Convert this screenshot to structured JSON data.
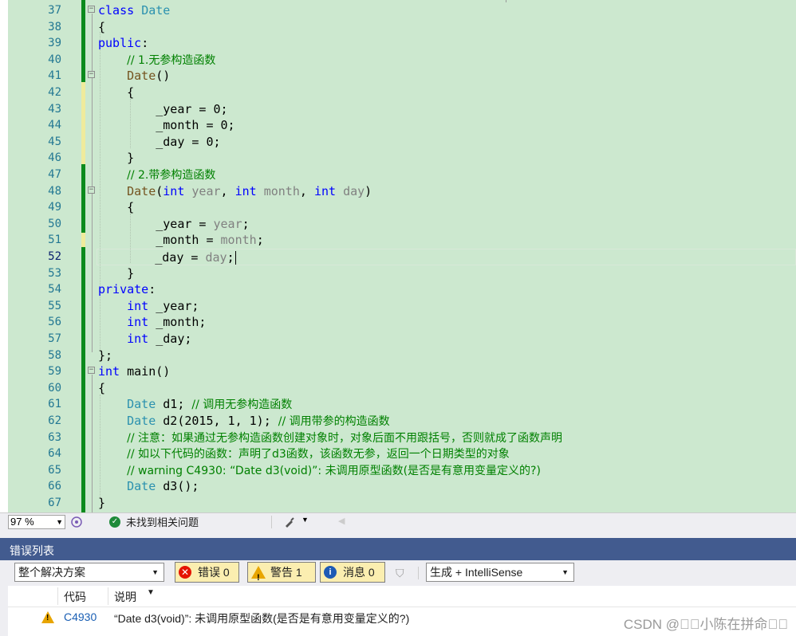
{
  "editor": {
    "lines": [
      {
        "n": "37",
        "segs": [
          [
            "kw",
            "class"
          ],
          [
            "",
            " "
          ],
          [
            "ty",
            "Date"
          ]
        ]
      },
      {
        "n": "38",
        "segs": [
          [
            "",
            "{"
          ]
        ]
      },
      {
        "n": "39",
        "segs": [
          [
            "kw",
            "public"
          ],
          [
            "",
            ":"
          ]
        ]
      },
      {
        "n": "40",
        "segs": [
          [
            "",
            "    "
          ],
          [
            "cm",
            "// 1.无参构造函数"
          ]
        ]
      },
      {
        "n": "41",
        "segs": [
          [
            "",
            "    "
          ],
          [
            "fn",
            "Date"
          ],
          [
            "",
            "()"
          ]
        ]
      },
      {
        "n": "42",
        "segs": [
          [
            "",
            "    {"
          ]
        ]
      },
      {
        "n": "43",
        "segs": [
          [
            "",
            "        _year = 0;"
          ]
        ]
      },
      {
        "n": "44",
        "segs": [
          [
            "",
            "        _month = 0;"
          ]
        ]
      },
      {
        "n": "45",
        "segs": [
          [
            "",
            "        _day = 0;"
          ]
        ]
      },
      {
        "n": "46",
        "segs": [
          [
            "",
            "    }"
          ]
        ]
      },
      {
        "n": "47",
        "segs": [
          [
            "",
            "    "
          ],
          [
            "cm",
            "// 2.带参构造函数"
          ]
        ]
      },
      {
        "n": "48",
        "segs": [
          [
            "",
            "    "
          ],
          [
            "fn",
            "Date"
          ],
          [
            "",
            "("
          ],
          [
            "kw",
            "int"
          ],
          [
            "",
            " "
          ],
          [
            "pm",
            "year"
          ],
          [
            "",
            ", "
          ],
          [
            "kw",
            "int"
          ],
          [
            "",
            " "
          ],
          [
            "pm",
            "month"
          ],
          [
            "",
            ", "
          ],
          [
            "kw",
            "int"
          ],
          [
            "",
            " "
          ],
          [
            "pm",
            "day"
          ],
          [
            "",
            ")"
          ]
        ]
      },
      {
        "n": "49",
        "segs": [
          [
            "",
            "    {"
          ]
        ]
      },
      {
        "n": "50",
        "segs": [
          [
            "",
            "        _year = "
          ],
          [
            "pm",
            "year"
          ],
          [
            "",
            ";"
          ]
        ]
      },
      {
        "n": "51",
        "segs": [
          [
            "",
            "        _month = "
          ],
          [
            "pm",
            "month"
          ],
          [
            "",
            ";"
          ]
        ]
      },
      {
        "n": "52",
        "segs": [
          [
            "",
            "        _day = "
          ],
          [
            "pm",
            "day"
          ],
          [
            "",
            ";"
          ]
        ]
      },
      {
        "n": "53",
        "segs": [
          [
            "",
            "    }"
          ]
        ]
      },
      {
        "n": "54",
        "segs": [
          [
            "kw",
            "private"
          ],
          [
            "",
            ":"
          ]
        ]
      },
      {
        "n": "55",
        "segs": [
          [
            "",
            "    "
          ],
          [
            "kw",
            "int"
          ],
          [
            "",
            " _year;"
          ]
        ]
      },
      {
        "n": "56",
        "segs": [
          [
            "",
            "    "
          ],
          [
            "kw",
            "int"
          ],
          [
            "",
            " _month;"
          ]
        ]
      },
      {
        "n": "57",
        "segs": [
          [
            "",
            "    "
          ],
          [
            "kw",
            "int"
          ],
          [
            "",
            " _day;"
          ]
        ]
      },
      {
        "n": "58",
        "segs": [
          [
            "",
            "};"
          ]
        ]
      },
      {
        "n": "59",
        "segs": [
          [
            "kw",
            "int"
          ],
          [
            "",
            " main()"
          ]
        ]
      },
      {
        "n": "60",
        "segs": [
          [
            "",
            "{"
          ]
        ]
      },
      {
        "n": "61",
        "segs": [
          [
            "",
            "    "
          ],
          [
            "ty",
            "Date"
          ],
          [
            "",
            " d1; "
          ],
          [
            "cm",
            "// 调用无参构造函数"
          ]
        ]
      },
      {
        "n": "62",
        "segs": [
          [
            "",
            "    "
          ],
          [
            "ty",
            "Date"
          ],
          [
            "",
            " d2(2015, 1, 1); "
          ],
          [
            "cm",
            "// 调用带参的构造函数"
          ]
        ]
      },
      {
        "n": "63",
        "segs": [
          [
            "",
            "    "
          ],
          [
            "cm",
            "// 注意：如果通过无参构造函数创建对象时，对象后面不用跟括号，否则就成了函数声明"
          ]
        ]
      },
      {
        "n": "64",
        "segs": [
          [
            "",
            "    "
          ],
          [
            "cm",
            "// 如以下代码的函数：声明了d3函数，该函数无参，返回一个日期类型的对象"
          ]
        ]
      },
      {
        "n": "65",
        "segs": [
          [
            "",
            "    "
          ],
          [
            "cm",
            "// warning C4930: “Date d3(void)”: 未调用原型函数(是否是有意用变量定义的?)"
          ]
        ]
      },
      {
        "n": "66",
        "segs": [
          [
            "",
            "    "
          ],
          [
            "ty",
            "Date"
          ],
          [
            "",
            " d3();"
          ]
        ]
      },
      {
        "n": "67",
        "segs": [
          [
            "",
            "}"
          ]
        ]
      }
    ]
  },
  "statusbar": {
    "zoom": "97 %",
    "issues_text": "未找到相关问题"
  },
  "error_list": {
    "title": "错误列表",
    "scope": "整个解决方案",
    "errors_label": "错误 0",
    "warnings_label": "警告 1",
    "messages_label": "消息 0",
    "source": "生成 + IntelliSense",
    "col_code": "代码",
    "col_desc": "说明",
    "rows": [
      {
        "code": "C4930",
        "desc": "“Date d3(void)”: 未调用原型函数(是否是有意用变量定义的?)"
      }
    ]
  },
  "watermark": "CSDN @\u0000\u0000小陈在拼命\u0000\u0000"
}
